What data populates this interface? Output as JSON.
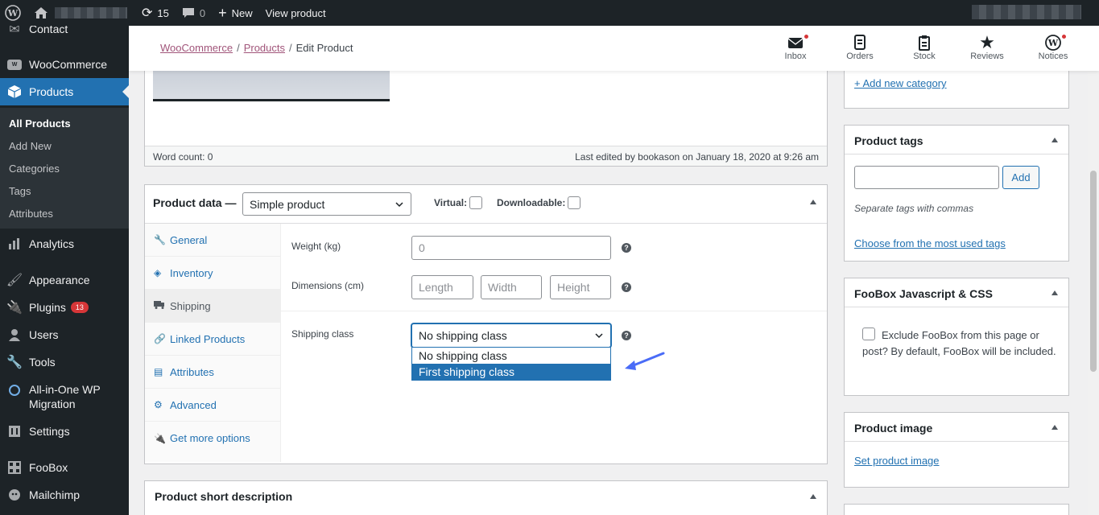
{
  "adminbar": {
    "updates_count": "15",
    "comments_count": "0",
    "new_label": "New",
    "view_product_label": "View product"
  },
  "sidebar": {
    "items": [
      {
        "label": "Contact"
      },
      {
        "label": "WooCommerce"
      },
      {
        "label": "Products"
      },
      {
        "label": "Analytics"
      },
      {
        "label": "Appearance"
      },
      {
        "label": "Plugins",
        "badge": "13"
      },
      {
        "label": "Users"
      },
      {
        "label": "Tools"
      },
      {
        "label": "All-in-One WP Migration"
      },
      {
        "label": "Settings"
      },
      {
        "label": "FooBox"
      },
      {
        "label": "Mailchimp"
      }
    ],
    "submenu": [
      "All Products",
      "Add New",
      "Categories",
      "Tags",
      "Attributes"
    ]
  },
  "header": {
    "breadcrumbs": [
      "WooCommerce",
      "Products",
      "Edit Product"
    ],
    "actions": [
      "Inbox",
      "Orders",
      "Stock",
      "Reviews",
      "Notices"
    ]
  },
  "editor": {
    "word_count": "Word count: 0",
    "last_edited": "Last edited by bookason on January 18, 2020 at 9:26 am"
  },
  "product_data": {
    "title": "Product data —",
    "type_selected": "Simple product",
    "virtual_label": "Virtual:",
    "downloadable_label": "Downloadable:",
    "tabs": [
      "General",
      "Inventory",
      "Shipping",
      "Linked Products",
      "Attributes",
      "Advanced",
      "Get more options"
    ],
    "weight_label": "Weight (kg)",
    "weight_placeholder": "0",
    "dimensions_label": "Dimensions (cm)",
    "length_placeholder": "Length",
    "width_placeholder": "Width",
    "height_placeholder": "Height",
    "shipping_class_label": "Shipping class",
    "shipping_class_selected": "No shipping class",
    "shipping_class_options": [
      "No shipping class",
      "First shipping class"
    ],
    "help_glyph": "?"
  },
  "short_description": {
    "title": "Product short description"
  },
  "right": {
    "add_category": "+ Add new category",
    "tags_title": "Product tags",
    "add_button": "Add",
    "tags_hint": "Separate tags with commas",
    "tags_link": "Choose from the most used tags",
    "foobox_title": "FooBox Javascript & CSS",
    "foobox_label": "Exclude FooBox from this page or post? By default, FooBox will be included.",
    "image_title": "Product image",
    "image_link": "Set product image"
  },
  "colors": {
    "admin_dark": "#1d2327",
    "admin_blue": "#2271b1",
    "woo_purple": "#a1557a",
    "annotation_arrow": "#4a6cf7"
  }
}
